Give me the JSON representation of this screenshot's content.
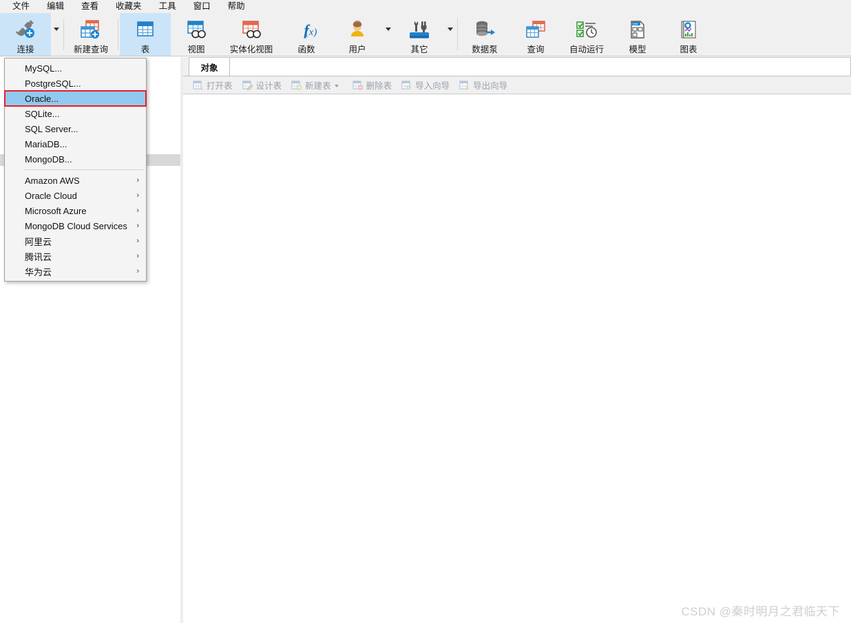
{
  "menubar": {
    "items": [
      {
        "label": "文件",
        "name": "menu-file"
      },
      {
        "label": "编辑",
        "name": "menu-edit"
      },
      {
        "label": "查看",
        "name": "menu-view"
      },
      {
        "label": "收藏夹",
        "name": "menu-favorites"
      },
      {
        "label": "工具",
        "name": "menu-tools"
      },
      {
        "label": "窗口",
        "name": "menu-window"
      },
      {
        "label": "帮助",
        "name": "menu-help"
      }
    ]
  },
  "ribbon": {
    "buttons": [
      {
        "label": "连接",
        "icon": "connection-icon",
        "caret": true,
        "active": true
      },
      {
        "label": "新建查询",
        "icon": "new-query-icon",
        "caret": false,
        "active": false
      },
      {
        "label": "表",
        "icon": "table-icon",
        "caret": false,
        "active": true
      },
      {
        "label": "视图",
        "icon": "view-icon",
        "caret": false,
        "active": false
      },
      {
        "label": "实体化视图",
        "icon": "materialized-view-icon",
        "caret": false,
        "active": false
      },
      {
        "label": "函数",
        "icon": "function-icon",
        "caret": false,
        "active": false
      },
      {
        "label": "用户",
        "icon": "user-icon",
        "caret": true,
        "active": false
      },
      {
        "label": "其它",
        "icon": "others-icon",
        "caret": true,
        "active": false
      },
      {
        "label": "数据泵",
        "icon": "data-pump-icon",
        "caret": false,
        "active": false
      },
      {
        "label": "查询",
        "icon": "query-icon",
        "caret": false,
        "active": false
      },
      {
        "label": "自动运行",
        "icon": "automation-icon",
        "caret": false,
        "active": false
      },
      {
        "label": "模型",
        "icon": "model-icon",
        "caret": false,
        "active": false
      },
      {
        "label": "图表",
        "icon": "chart-icon",
        "caret": false,
        "active": false
      }
    ]
  },
  "tabstrip": {
    "tabs": [
      {
        "label": "对象",
        "selected": true
      }
    ]
  },
  "object_toolbar": {
    "buttons": [
      {
        "label": "打开表",
        "icon": "open-table-icon",
        "caret": false
      },
      {
        "label": "设计表",
        "icon": "design-table-icon",
        "caret": false
      },
      {
        "label": "新建表",
        "icon": "new-table-icon",
        "caret": true
      },
      {
        "label": "删除表",
        "icon": "delete-table-icon",
        "caret": false
      },
      {
        "label": "导入向导",
        "icon": "import-wizard-icon",
        "caret": false
      },
      {
        "label": "导出向导",
        "icon": "export-wizard-icon",
        "caret": false
      }
    ]
  },
  "connection_menu": {
    "items": [
      {
        "label": "MySQL...",
        "submenu": false,
        "highlighted": false
      },
      {
        "label": "PostgreSQL...",
        "submenu": false,
        "highlighted": false
      },
      {
        "label": "Oracle...",
        "submenu": false,
        "highlighted": true
      },
      {
        "label": "SQLite...",
        "submenu": false,
        "highlighted": false
      },
      {
        "label": "SQL Server...",
        "submenu": false,
        "highlighted": false
      },
      {
        "label": "MariaDB...",
        "submenu": false,
        "highlighted": false
      },
      {
        "label": "MongoDB...",
        "submenu": false,
        "highlighted": false
      },
      {
        "separator": true
      },
      {
        "label": "Amazon AWS",
        "submenu": true,
        "highlighted": false
      },
      {
        "label": "Oracle Cloud",
        "submenu": true,
        "highlighted": false
      },
      {
        "label": "Microsoft Azure",
        "submenu": true,
        "highlighted": false
      },
      {
        "label": "MongoDB Cloud Services",
        "submenu": true,
        "highlighted": false
      },
      {
        "label": "阿里云",
        "submenu": true,
        "highlighted": false
      },
      {
        "label": "腾讯云",
        "submenu": true,
        "highlighted": false
      },
      {
        "label": "华为云",
        "submenu": true,
        "highlighted": false
      }
    ],
    "submenu_arrow": "›",
    "highlight_color": "#91c9f0",
    "annotation_box_color": "#ee1c25"
  },
  "watermark": {
    "text": "CSDN @秦时明月之君临天下"
  }
}
